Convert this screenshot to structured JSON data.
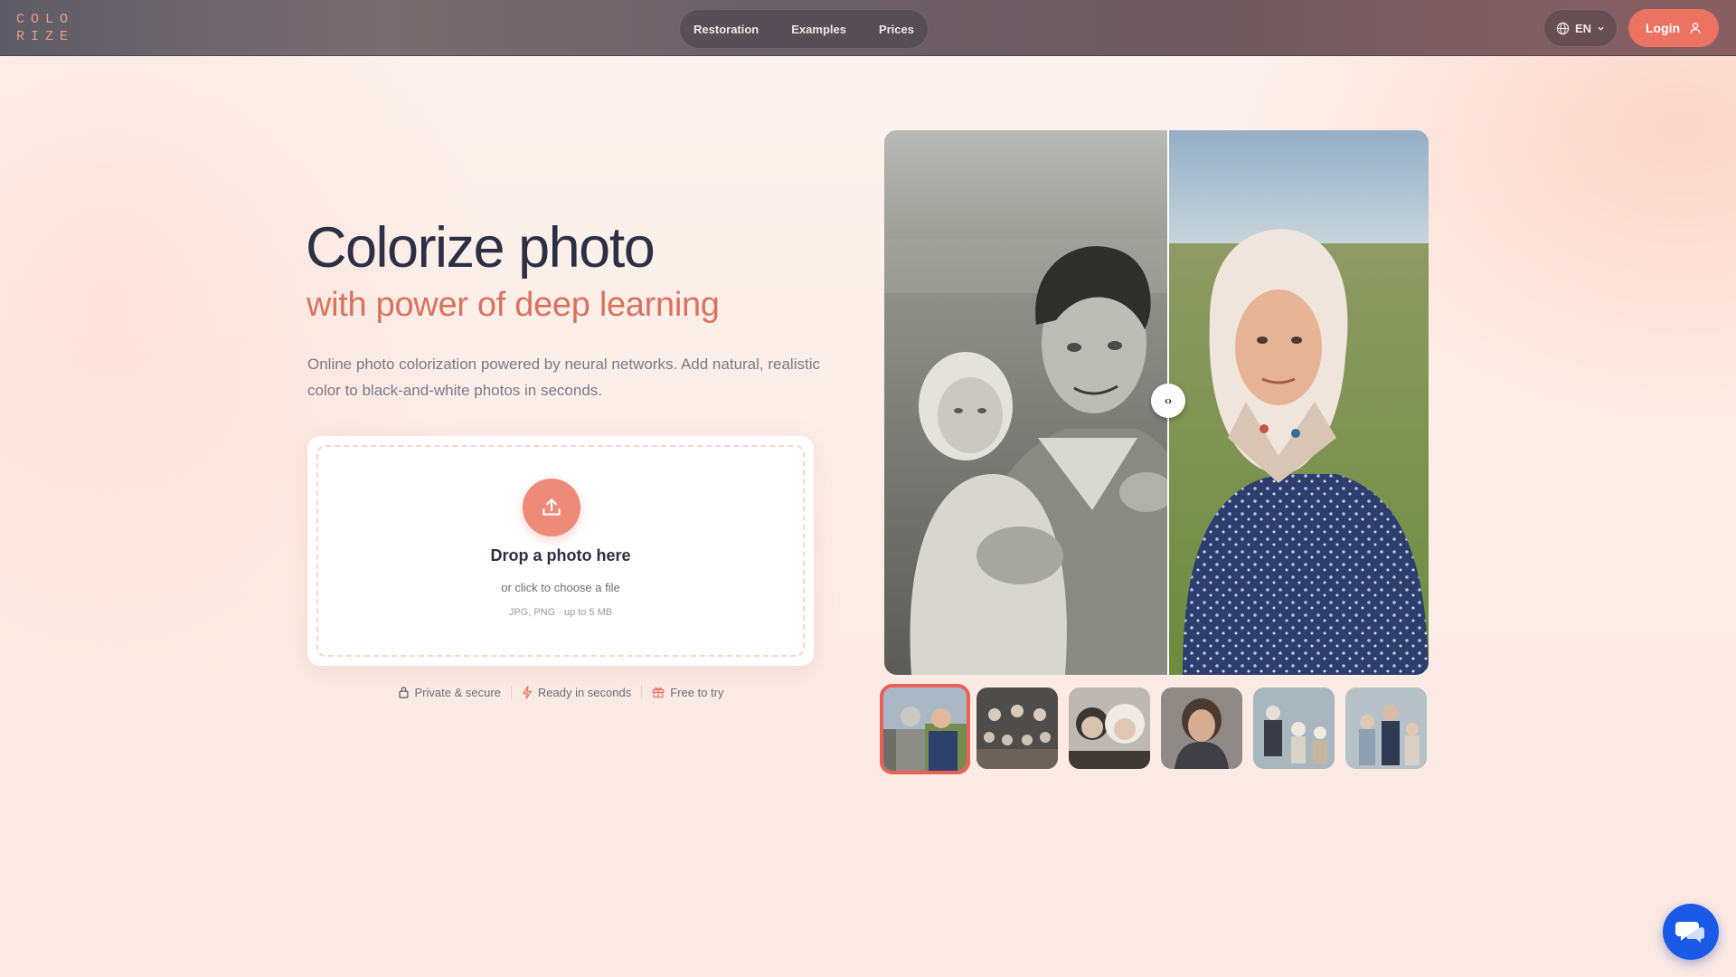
{
  "header": {
    "logo_line1": "COLO",
    "logo_line2": "RIZE",
    "nav": [
      "Restoration",
      "Examples",
      "Prices"
    ],
    "language": "EN",
    "login_label": "Login"
  },
  "hero": {
    "title": "Colorize photo",
    "subtitle": "with power of deep learning",
    "description": "Online photo colorization powered by neural networks. Add natural, realistic color to black-and-white photos in seconds."
  },
  "upload": {
    "title": "Drop a photo here",
    "subtitle": "or click to choose a file",
    "hint": "JPG, PNG · up to 5 MB"
  },
  "features": [
    "Private & secure",
    "Ready in seconds",
    "Free to try"
  ],
  "compare": {
    "handle_glyph": "‹›"
  },
  "colors": {
    "accent": "#ec7263",
    "title": "#2d2f45",
    "subtitle": "#d9725c",
    "chat": "#1a5ae6"
  },
  "icons": {
    "language": "globe-icon",
    "login": "user-icon",
    "upload": "upload-icon",
    "private": "lock-icon",
    "ready": "lightning-icon",
    "free": "gift-icon",
    "chat": "chat-icon"
  }
}
